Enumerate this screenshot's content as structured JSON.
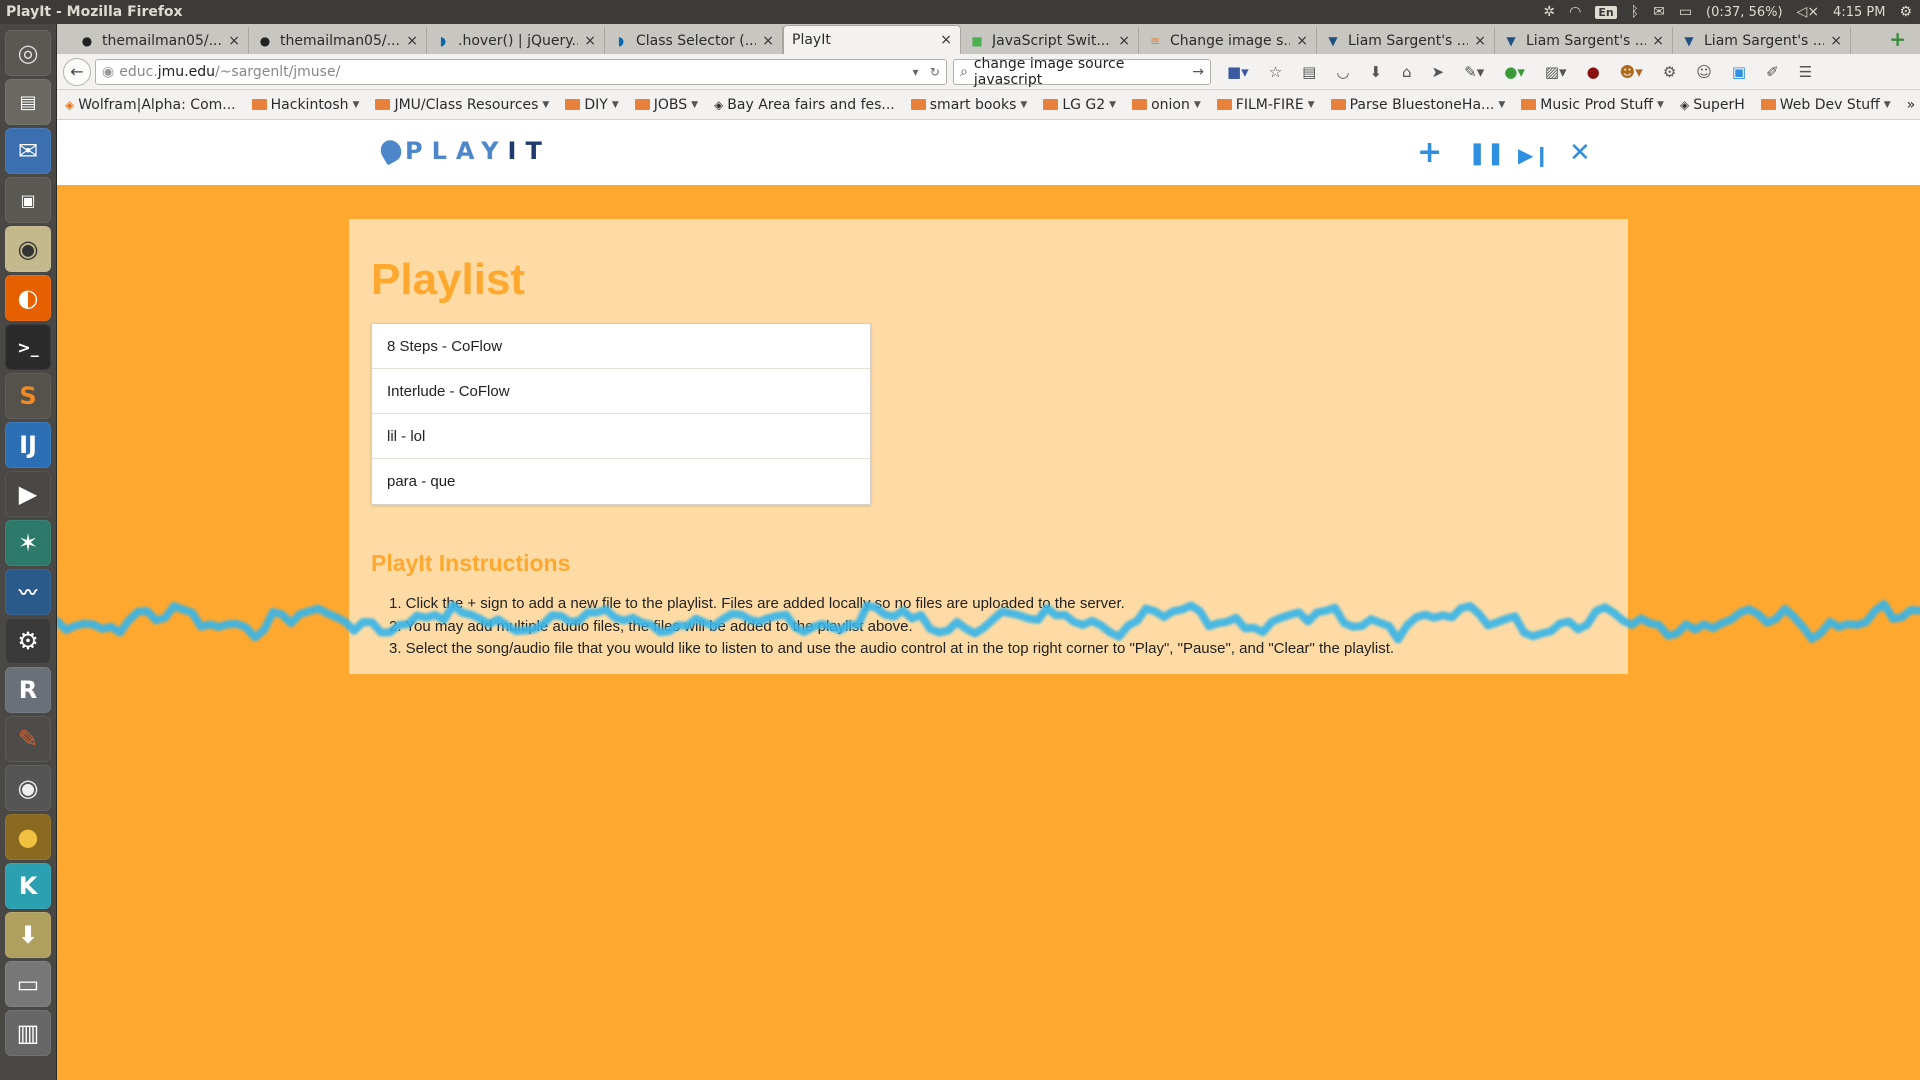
{
  "system": {
    "window_title": "PlayIt - Mozilla Firefox",
    "lang": "En",
    "battery": "(0:37, 56%)",
    "clock": "4:15 PM"
  },
  "tabs": [
    {
      "label": "themailman05/...",
      "icon": "github-icon"
    },
    {
      "label": "themailman05/...",
      "icon": "github-icon"
    },
    {
      "label": ".hover() | jQuery...",
      "icon": "jquery-icon"
    },
    {
      "label": "Class Selector (...",
      "icon": "jquery-icon"
    },
    {
      "label": "PlayIt",
      "icon": "",
      "active": true
    },
    {
      "label": "JavaScript Swit...",
      "icon": "w3schools-icon"
    },
    {
      "label": "Change image s...",
      "icon": "stackoverflow-icon"
    },
    {
      "label": "Liam Sargent's ...",
      "icon": "bitbucket-icon"
    },
    {
      "label": "Liam Sargent's ...",
      "icon": "bitbucket-icon"
    },
    {
      "label": "Liam Sargent's ...",
      "icon": "bitbucket-icon"
    }
  ],
  "nav": {
    "url_prefix": "educ.",
    "url_domain": "jmu.edu",
    "url_path": "/~sargenlt/jmuse/",
    "search_value": "change image source javascript"
  },
  "bookmarks": [
    {
      "label": "Wolfram|Alpha: Com...",
      "type": "site",
      "caret": false
    },
    {
      "label": "Hackintosh",
      "type": "folder",
      "caret": true
    },
    {
      "label": "JMU/Class Resources",
      "type": "folder",
      "caret": true
    },
    {
      "label": "DIY",
      "type": "folder",
      "caret": true
    },
    {
      "label": "JOBS",
      "type": "folder",
      "caret": true
    },
    {
      "label": "Bay Area fairs and fes...",
      "type": "site",
      "caret": false
    },
    {
      "label": "smart books",
      "type": "folder",
      "caret": true
    },
    {
      "label": "LG G2",
      "type": "folder",
      "caret": true
    },
    {
      "label": "onion",
      "type": "folder",
      "caret": true
    },
    {
      "label": "FILM-FIRE",
      "type": "folder",
      "caret": true
    },
    {
      "label": "Parse BluestoneHa...",
      "type": "folder",
      "caret": true
    },
    {
      "label": "Music Prod Stuff",
      "type": "folder",
      "caret": true
    },
    {
      "label": "SuperH",
      "type": "site",
      "caret": false
    },
    {
      "label": "Web Dev Stuff",
      "type": "folder",
      "caret": true
    }
  ],
  "app": {
    "logo_play": "PLAY",
    "logo_it": "IT",
    "controls": {
      "add": "+",
      "pause": "❚❚",
      "next": "▶❙",
      "clear": "✕"
    },
    "playlist_title": "Playlist",
    "playlist": [
      "8 Steps - CoFlow",
      "Interlude - CoFlow",
      "lil - lol",
      "para - que"
    ],
    "instructions_title": "PlayIt Instructions",
    "instructions": [
      "1. Click the + sign to add a new file to the playlist. Files are added locally so no files are uploaded to the server.",
      "2. You may add multiple audio files, the files will be added to the playlist above.",
      "3. Select the song/audio file that you would like to listen to and use the audio control at in the top right corner to \"Play\", \"Pause\", and \"Clear\" the playlist."
    ],
    "colors": {
      "accent": "#fea82f",
      "card": "#fedba4",
      "control": "#2f8fe0",
      "wave": "#36b5ea"
    }
  }
}
